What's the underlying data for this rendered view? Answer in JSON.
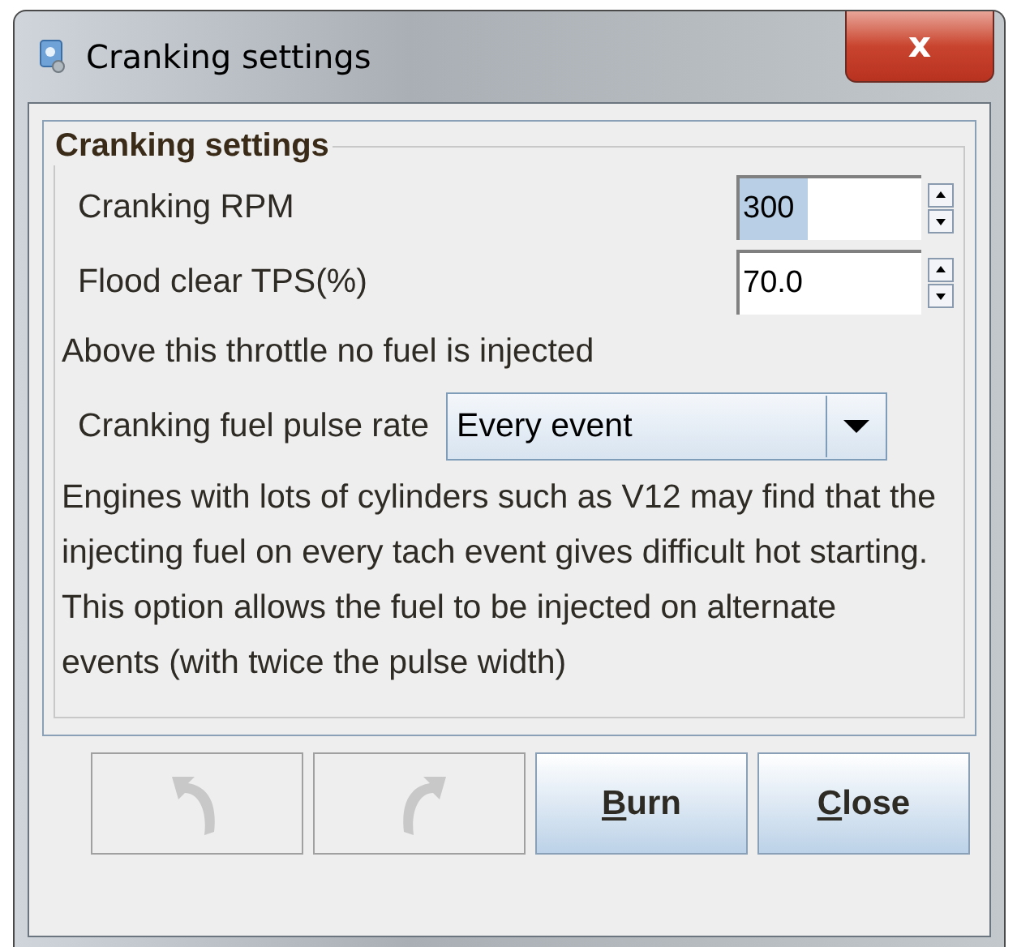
{
  "window": {
    "title": "Cranking settings",
    "close": "x"
  },
  "group": {
    "title": "Cranking settings"
  },
  "fields": [
    {
      "kind": "spinner",
      "label": "Cranking RPM",
      "value": "300",
      "selected": true
    },
    {
      "kind": "spinner",
      "label": "Flood clear TPS(%)",
      "value": "70.0",
      "selected": false
    },
    {
      "kind": "note",
      "label": "Above this throttle no fuel is injected"
    },
    {
      "kind": "combo",
      "label": "Cranking fuel pulse rate",
      "value": "Every event"
    },
    {
      "kind": "note",
      "label": "Engines with lots of cylinders such as V12 may find that the injecting fuel on every tach event gives difficult hot starting. This option allows the fuel to be injected on alternate events (with twice the pulse width)"
    }
  ],
  "buttons": [
    {
      "kind": "undo",
      "disabled": true
    },
    {
      "kind": "redo",
      "disabled": true
    },
    {
      "kind": "text",
      "label": "Burn",
      "mnemonic_underlined": true,
      "disabled": false
    },
    {
      "kind": "text",
      "label": "Close",
      "mnemonic_underlined": true,
      "disabled": false
    }
  ]
}
